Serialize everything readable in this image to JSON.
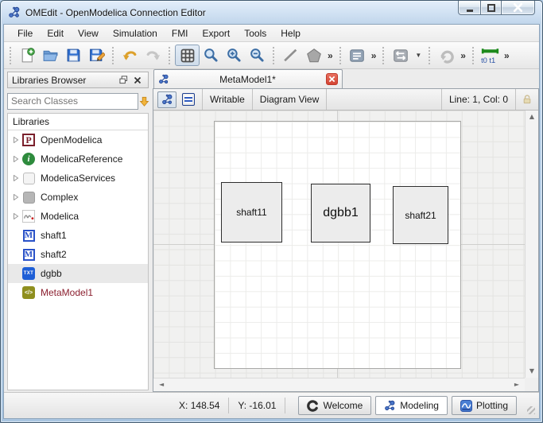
{
  "window": {
    "title": "OMEdit - OpenModelica Connection Editor"
  },
  "menubar": {
    "items": [
      "File",
      "Edit",
      "View",
      "Simulation",
      "FMI",
      "Export",
      "Tools",
      "Help"
    ]
  },
  "toolbar": {
    "buttons": [
      "new-model",
      "open-file",
      "save",
      "save-as",
      "undo",
      "redo",
      "show-grid",
      "zoom-fit",
      "zoom-in",
      "zoom-out",
      "line-shape",
      "polygon-shape",
      "shapes-more",
      "text-shape",
      "text-more",
      "connect-mode",
      "connect-menu",
      "re-simulate",
      "re-simulate-more",
      "simulation-time",
      "simulation-more"
    ]
  },
  "libraries_browser": {
    "title": "Libraries Browser",
    "search_placeholder": "Search Classes",
    "tree_header": "Libraries",
    "items": [
      {
        "label": "OpenModelica",
        "icon": "openmodelica-icon",
        "expandable": true
      },
      {
        "label": "ModelicaReference",
        "icon": "info-icon",
        "expandable": true
      },
      {
        "label": "ModelicaServices",
        "icon": "package-icon",
        "expandable": true
      },
      {
        "label": "Complex",
        "icon": "package-icon",
        "expandable": true
      },
      {
        "label": "Modelica",
        "icon": "modelica-icon",
        "expandable": true
      },
      {
        "label": "shaft1",
        "icon": "model-icon",
        "expandable": false
      },
      {
        "label": "shaft2",
        "icon": "model-icon",
        "expandable": false
      },
      {
        "label": "dgbb",
        "icon": "text-file-icon",
        "expandable": false,
        "highlighted": true
      },
      {
        "label": "MetaModel1",
        "icon": "metamodel-icon",
        "expandable": false,
        "modified": true
      }
    ]
  },
  "editor": {
    "tab": {
      "label": "MetaModel1*"
    },
    "toolbar": {
      "writable": "Writable",
      "view_mode": "Diagram View",
      "cursor": "Line: 1, Col: 0"
    },
    "blocks": [
      {
        "label": "shaft11"
      },
      {
        "label": "dgbb1"
      },
      {
        "label": "shaft21"
      }
    ]
  },
  "status_bar": {
    "x": "X: 148.54",
    "y": "Y: -16.01",
    "perspectives": [
      {
        "label": "Welcome"
      },
      {
        "label": "Modeling",
        "active": true
      },
      {
        "label": "Plotting"
      }
    ]
  },
  "colors": {
    "accent_blue": "#2a52a5",
    "close_red": "#c73d27",
    "modified_class_red": "#8b1f2f",
    "canvas_grid": "#e3e3e1",
    "selection_gray": "#e9e9e9",
    "block_fill": "#ececec"
  }
}
